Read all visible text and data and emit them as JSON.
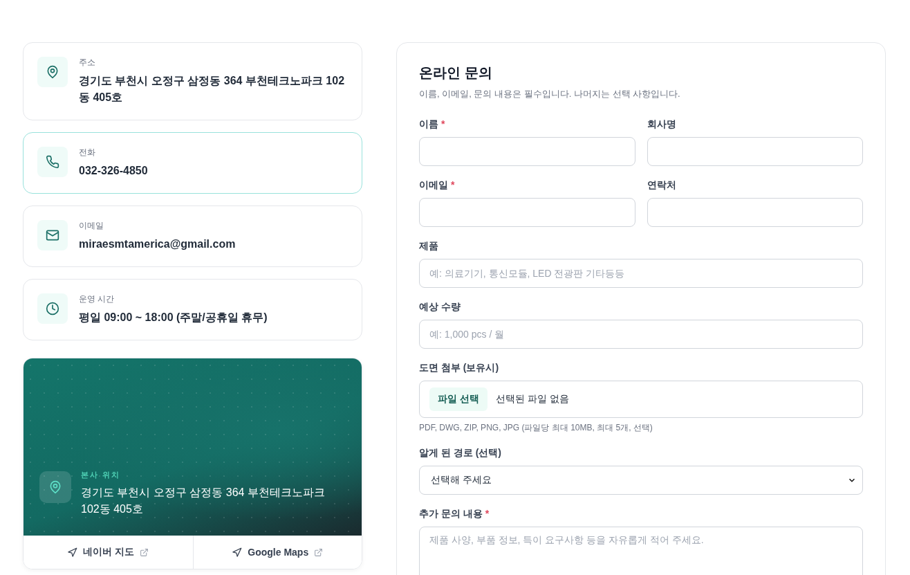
{
  "contacts": [
    {
      "kind": "pin",
      "label": "주소",
      "value": "경기도 부천시 오정구 삼정동 364 부천테크노파크 102동 405호",
      "highlighted": false
    },
    {
      "kind": "phone",
      "label": "전화",
      "value": "032-326-4850",
      "highlighted": true
    },
    {
      "kind": "mail",
      "label": "이메일",
      "value": "miraesmtamerica@gmail.com",
      "highlighted": false
    },
    {
      "kind": "clock",
      "label": "운영 시간",
      "value": "평일 09:00 ~ 18:00 (주말/공휴일 휴무)",
      "highlighted": false
    }
  ],
  "map": {
    "label": "본사 위치",
    "address": "경기도 부천시 오정구 삼정동 364 부천테크노파크 102동 405호",
    "links": [
      {
        "label": "네이버 지도"
      },
      {
        "label": "Google Maps"
      }
    ]
  },
  "form": {
    "title": "온라인 문의",
    "required_mark": "*",
    "subtitle": "이름, 이메일, 문의 내용은 필수입니다. 나머지는 선택 사항입니다.",
    "rows": [
      {
        "fields": [
          {
            "kind": "text",
            "label": "이름",
            "required": true
          },
          {
            "kind": "text",
            "label": "회사명",
            "required": false
          }
        ]
      },
      {
        "fields": [
          {
            "kind": "text",
            "label": "이메일",
            "required": true
          },
          {
            "kind": "text",
            "label": "연락처",
            "required": false
          }
        ]
      },
      {
        "fields": [
          {
            "kind": "text",
            "label": "제품",
            "required": false,
            "placeholder": "예: 의료기기, 통신모듈, LED 전광판 기타등등"
          }
        ]
      },
      {
        "fields": [
          {
            "kind": "text",
            "label": "예상 수량",
            "required": false,
            "placeholder": "예: 1,000 pcs / 월"
          }
        ]
      },
      {
        "fields": [
          {
            "kind": "file",
            "label": "도면 첨부 (보유시)",
            "required": false,
            "button": "파일 선택",
            "value": "선택된 파일 없음",
            "hint": "PDF, DWG, ZIP, PNG, JPG (파일당 최대 10MB, 최대 5개, 선택)"
          }
        ]
      },
      {
        "fields": [
          {
            "kind": "select",
            "label": "알게 된 경로 (선택)",
            "required": false,
            "value": "선택해 주세요"
          }
        ]
      },
      {
        "fields": [
          {
            "kind": "textarea",
            "label": "추가 문의 내용",
            "required": true,
            "placeholder": "제품 사양, 부품 정보, 특이 요구사항 등을 자유롭게 적어 주세요."
          }
        ]
      }
    ]
  }
}
